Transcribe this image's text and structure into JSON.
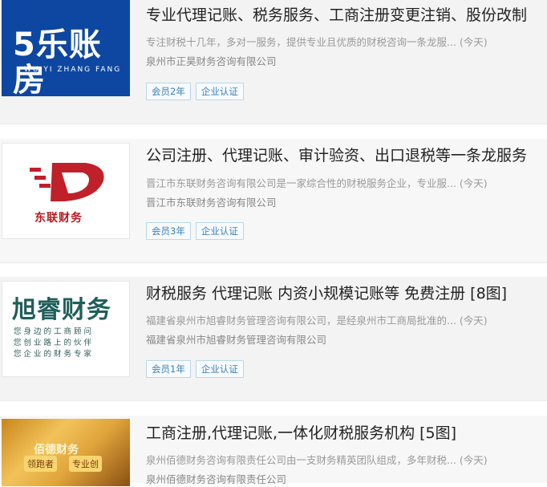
{
  "listings": [
    {
      "title": "专业代理记账、税务服务、工商注册变更注销、股份改制",
      "desc": "专注财税十几年，多对一服务，提供专业且优质的财税咨询一条龙服... (今天)",
      "company": "泉州市正昊财务咨询有限公司",
      "badges": [
        "会员2年",
        "企业认证"
      ],
      "logo": {
        "text": "5乐账房",
        "sub": "WU YI ZHANG FANG",
        "color": "#0d47a1"
      }
    },
    {
      "title": "公司注册、代理记账、审计验资、出口退税等一条龙服务",
      "desc": "晋江市东联财务咨询有限公司是一家综合性的财税服务企业，专业服... (今天)",
      "company": "晋江市东联财务咨询有限公司",
      "badges": [
        "会员3年",
        "企业认证"
      ],
      "logo": {
        "text": "东联财务",
        "icon": "d-swoosh-logo",
        "color": "#b5191f"
      }
    },
    {
      "title": "财税服务 代理记账 内资小规模记账等 免费注册 [8图]",
      "desc": "福建省泉州市旭睿财务管理咨询有限公司，是经泉州市工商局批准的... (今天)",
      "company": "福建省泉州市旭睿财务管理咨询有限公司",
      "badges": [
        "会员1年",
        "企业认证"
      ],
      "logo": {
        "text": "旭睿财务",
        "lines": [
          "您身边的工商顾问",
          "您创业路上的伙伴",
          "您企业的财务专家"
        ],
        "color": "#1f5e5b"
      }
    },
    {
      "title": "工商注册,代理记账,一体化财税服务机构 [5图]",
      "desc": "泉州佰德财务咨询有限责任公司由一支财务精英团队组成，多年财税... (今天)",
      "company": "泉州佰德财务咨询有限责任公司",
      "badges": [],
      "logo": {
        "t1": "佰德财务",
        "t2": "领跑者",
        "t3": "专业创"
      }
    }
  ]
}
